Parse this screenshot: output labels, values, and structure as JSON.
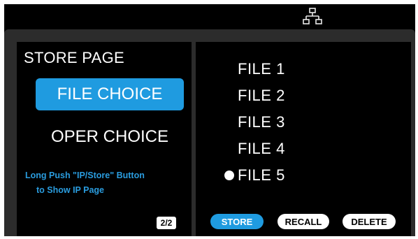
{
  "header": {
    "network_icon": "network-icon"
  },
  "left_panel": {
    "title": "STORE PAGE",
    "file_choice_label": "FILE CHOICE",
    "oper_choice_label": "OPER CHOICE",
    "hint_line1": "Long Push \"IP/Store\" Button",
    "hint_line2": "to Show IP Page",
    "page_indicator": "2/2"
  },
  "right_panel": {
    "files": [
      {
        "label": "FILE 1",
        "selected": false
      },
      {
        "label": "FILE 2",
        "selected": false
      },
      {
        "label": "FILE 3",
        "selected": false
      },
      {
        "label": "FILE 4",
        "selected": false
      },
      {
        "label": "FILE 5",
        "selected": true
      }
    ],
    "buttons": {
      "store": "STORE",
      "recall": "RECALL",
      "delete": "DELETE"
    }
  },
  "colors": {
    "accent": "#1f9be0",
    "hint": "#2a9cde",
    "background": "#000000",
    "bezel": "#2c2c2c"
  }
}
